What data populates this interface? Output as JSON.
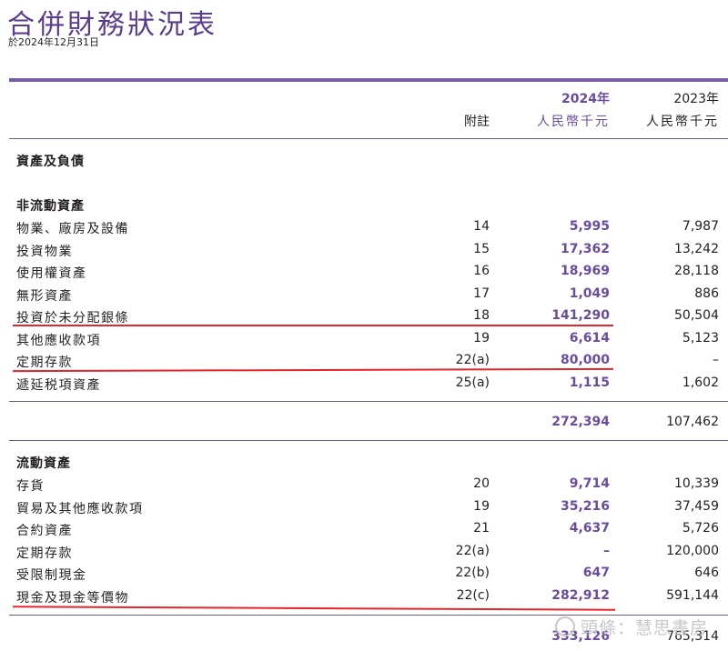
{
  "header": {
    "title": "合併財務狀況表",
    "subtitle": "於2024年12月31日",
    "col_note": "附註",
    "col_2024_year": "2024年",
    "col_2024_unit": "人民幣千元",
    "col_2023_year": "2023年",
    "col_2023_unit": "人民幣千元"
  },
  "sections": {
    "assets_liabilities": "資產及負債",
    "non_current": "非流動資產",
    "current": "流動資產"
  },
  "non_current_rows": [
    {
      "label": "物業、廠房及設備",
      "note": "14",
      "v2024": "5,995",
      "v2023": "7,987"
    },
    {
      "label": "投資物業",
      "note": "15",
      "v2024": "17,362",
      "v2023": "13,242"
    },
    {
      "label": "使用權資產",
      "note": "16",
      "v2024": "18,969",
      "v2023": "28,118"
    },
    {
      "label": "無形資產",
      "note": "17",
      "v2024": "1,049",
      "v2023": "886"
    },
    {
      "label": "投資於未分配銀條",
      "note": "18",
      "v2024": "141,290",
      "v2023": "50,504"
    },
    {
      "label": "其他應收款項",
      "note": "19",
      "v2024": "6,614",
      "v2023": "5,123"
    },
    {
      "label": "定期存款",
      "note": "22(a)",
      "v2024": "80,000",
      "v2023": "–"
    },
    {
      "label": "遞延税項資產",
      "note": "25(a)",
      "v2024": "1,115",
      "v2023": "1,602"
    }
  ],
  "non_current_total": {
    "v2024": "272,394",
    "v2023": "107,462"
  },
  "current_rows": [
    {
      "label": "存貨",
      "note": "20",
      "v2024": "9,714",
      "v2023": "10,339"
    },
    {
      "label": "貿易及其他應收款項",
      "note": "19",
      "v2024": "35,216",
      "v2023": "37,459"
    },
    {
      "label": "合約資產",
      "note": "21",
      "v2024": "4,637",
      "v2023": "5,726"
    },
    {
      "label": "定期存款",
      "note": "22(a)",
      "v2024": "–",
      "v2023": "120,000"
    },
    {
      "label": "受限制現金",
      "note": "22(b)",
      "v2024": "647",
      "v2023": "646"
    },
    {
      "label": "現金及現金等價物",
      "note": "22(c)",
      "v2024": "282,912",
      "v2023": "591,144"
    }
  ],
  "current_total": {
    "v2024": "333,126",
    "v2023": "765,314"
  },
  "watermark": "頭條：慧思書房",
  "colors": {
    "accent": "#6a4c9c",
    "rule": "#7b5ca6",
    "highlight": "#e4252b"
  }
}
